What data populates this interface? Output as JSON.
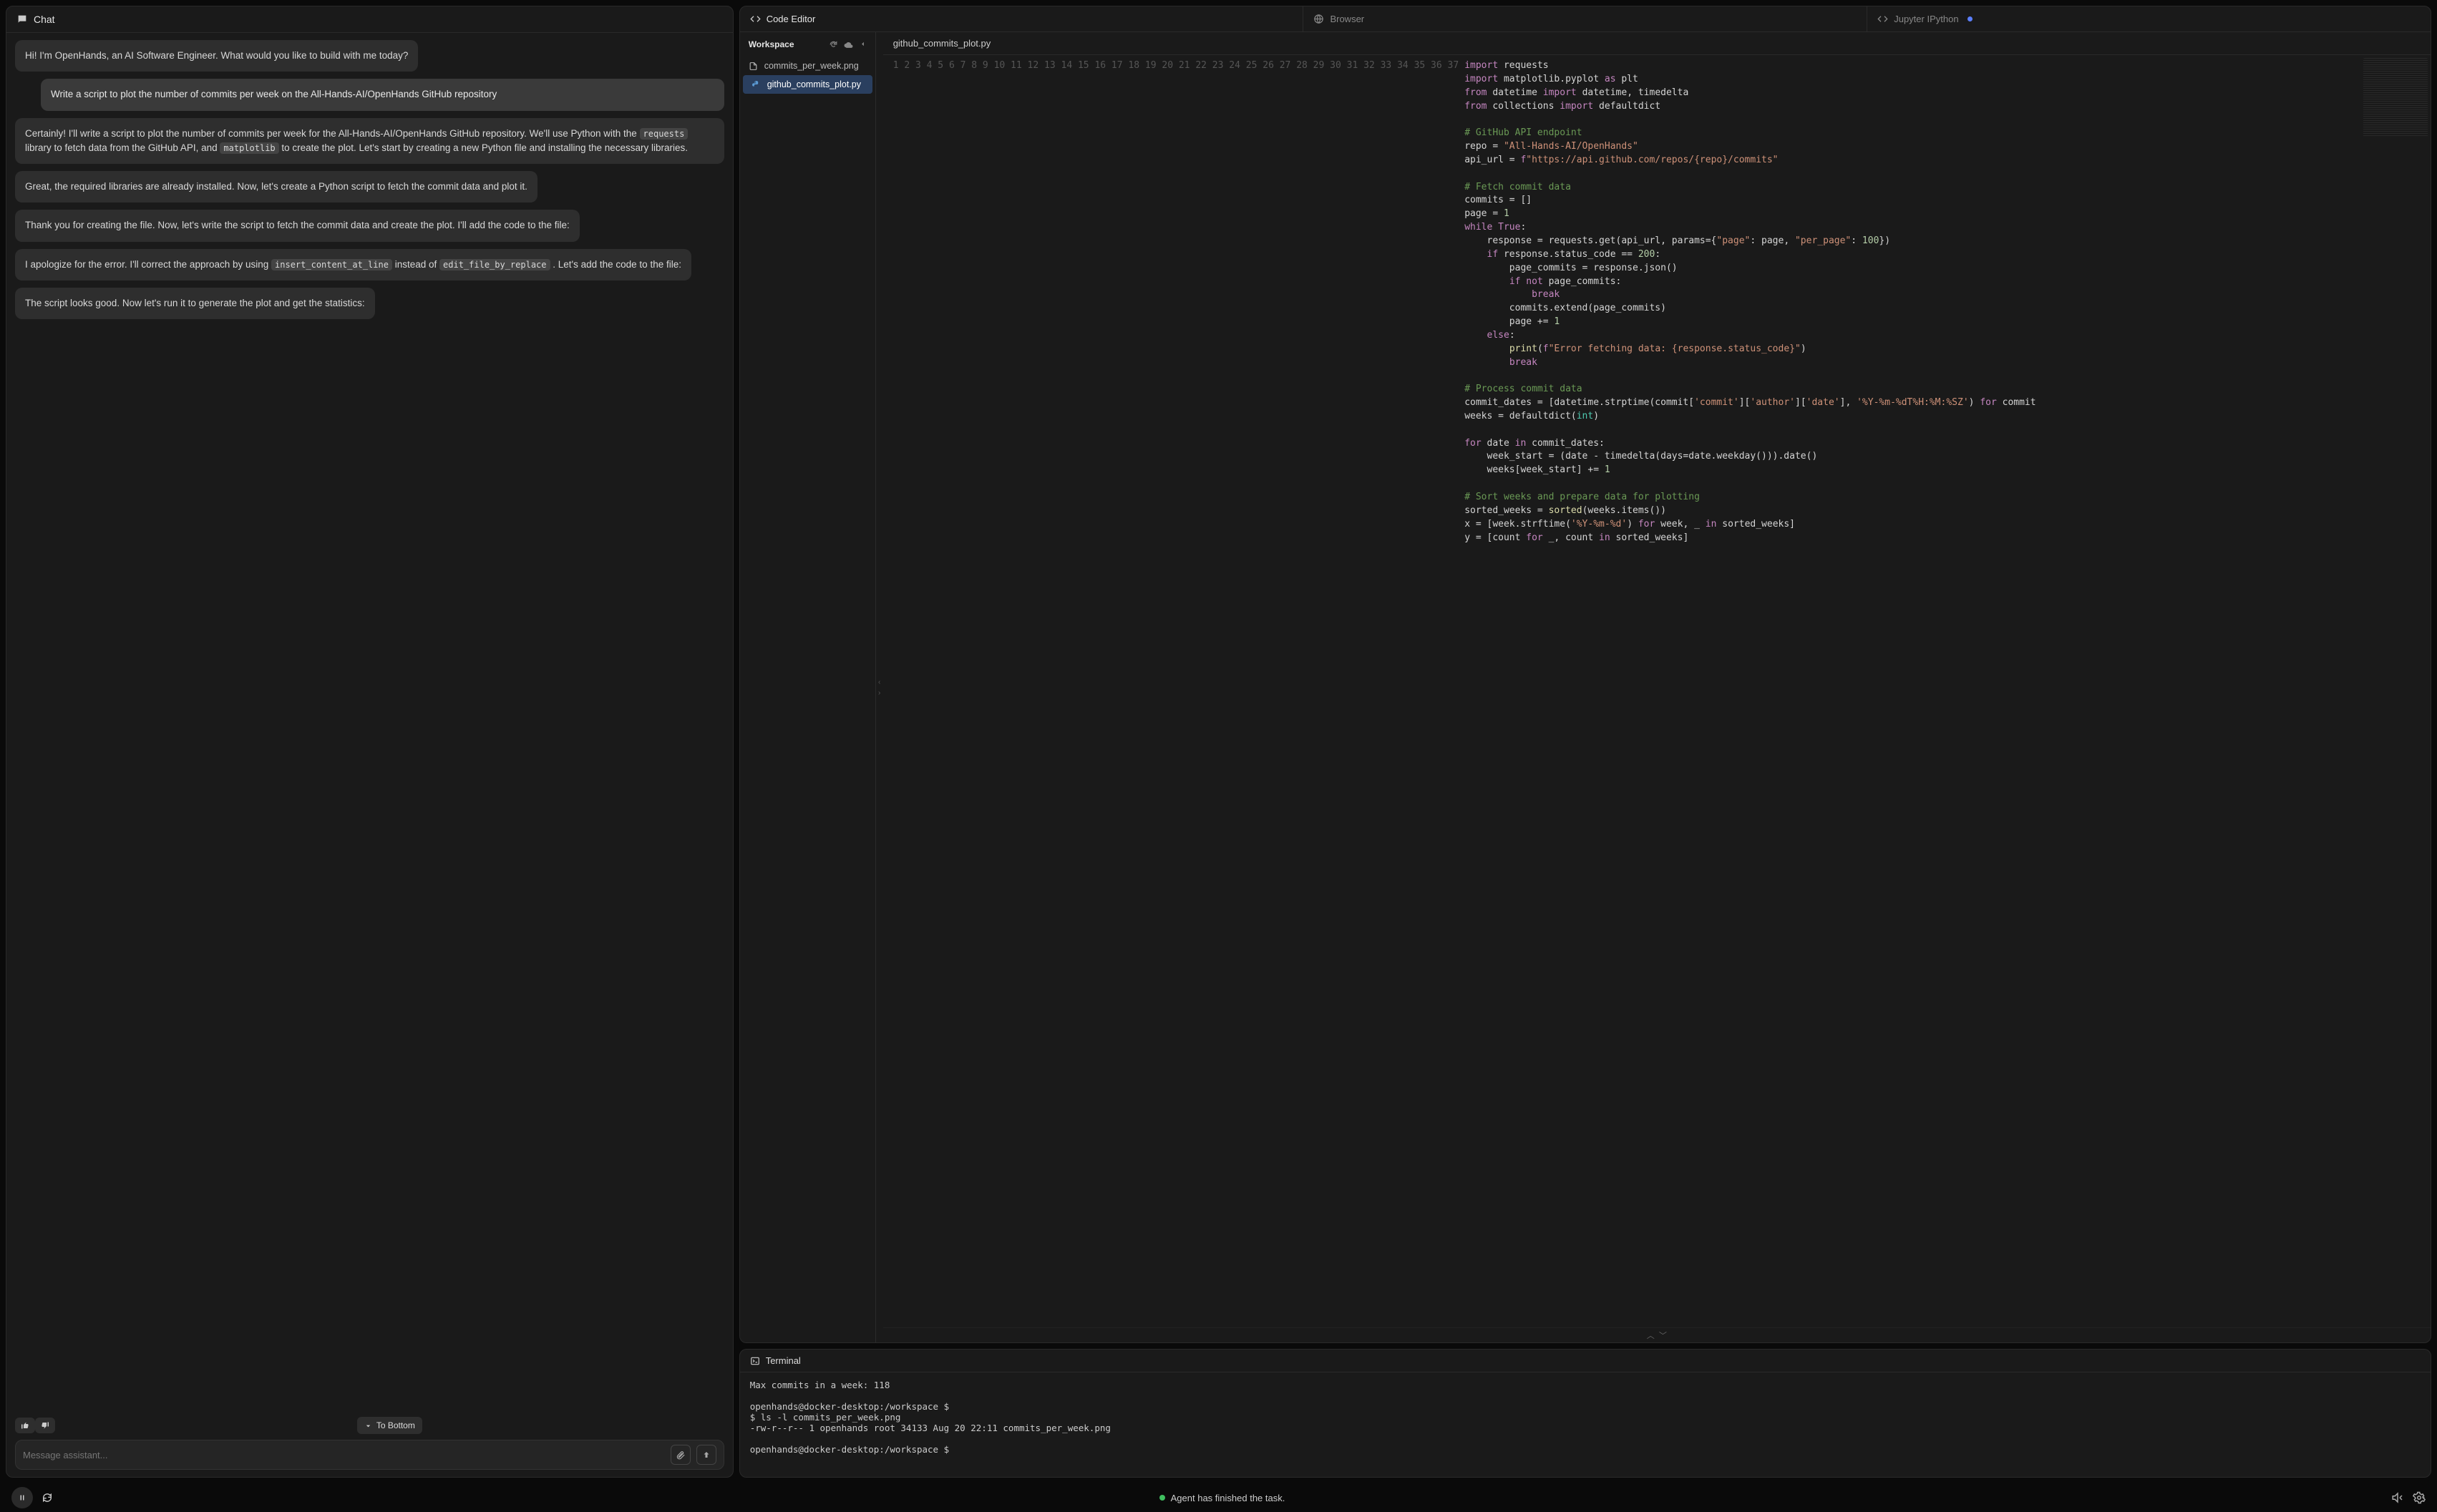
{
  "chat": {
    "title": "Chat",
    "messages": [
      {
        "role": "assistant",
        "text": "Hi! I'm OpenHands, an AI Software Engineer. What would you like to build with me today?"
      },
      {
        "role": "user",
        "text": "Write a script to plot the number of commits per week on the All-Hands-AI/OpenHands GitHub repository"
      },
      {
        "role": "assistant",
        "html": "Certainly! I'll write a script to plot the number of commits per week for the All-Hands-AI/OpenHands GitHub repository. We'll use Python with the <span class='code-chip'>requests</span> library to fetch data from the GitHub API, and <span class='code-chip'>matplotlib</span> to create the plot. Let's start by creating a new Python file and installing the necessary libraries."
      },
      {
        "role": "assistant",
        "text": "Great, the required libraries are already installed. Now, let's create a Python script to fetch the commit data and plot it."
      },
      {
        "role": "assistant",
        "text": "Thank you for creating the file. Now, let's write the script to fetch the commit data and create the plot. I'll add the code to the file:"
      },
      {
        "role": "assistant",
        "html": "I apologize for the error. I'll correct the approach by using <span class='code-chip'>insert_content_at_line</span> instead of <span class='code-chip'>edit_file_by_replace</span> . Let's add the code to the file:"
      },
      {
        "role": "assistant",
        "text": "The script looks good. Now let's run it to generate the plot and get the statistics:"
      }
    ],
    "to_bottom": "To Bottom",
    "input_placeholder": "Message assistant..."
  },
  "tabs": {
    "code": "Code Editor",
    "browser": "Browser",
    "jupyter": "Jupyter IPython"
  },
  "workspace": {
    "title": "Workspace",
    "files": [
      {
        "name": "commits_per_week.png",
        "type": "image",
        "selected": false
      },
      {
        "name": "github_commits_plot.py",
        "type": "python",
        "selected": true
      }
    ]
  },
  "open_file": "github_commits_plot.py",
  "code": {
    "lines": [
      [
        [
          "kw",
          "import"
        ],
        [
          "",
          " requests"
        ]
      ],
      [
        [
          "kw",
          "import"
        ],
        [
          "",
          " matplotlib.pyplot "
        ],
        [
          "kw",
          "as"
        ],
        [
          "",
          " plt"
        ]
      ],
      [
        [
          "kw",
          "from"
        ],
        [
          "",
          " datetime "
        ],
        [
          "kw",
          "import"
        ],
        [
          "",
          " datetime, timedelta"
        ]
      ],
      [
        [
          "kw",
          "from"
        ],
        [
          "",
          " collections "
        ],
        [
          "kw",
          "import"
        ],
        [
          "",
          " defaultdict"
        ]
      ],
      [],
      [
        [
          "com",
          "# GitHub API endpoint"
        ]
      ],
      [
        [
          "",
          "repo = "
        ],
        [
          "str",
          "\"All-Hands-AI/OpenHands\""
        ]
      ],
      [
        [
          "",
          "api_url = "
        ],
        [
          "kw",
          "f"
        ],
        [
          "str",
          "\"https://api.github.com/repos/{repo}/commits\""
        ]
      ],
      [],
      [
        [
          "com",
          "# Fetch commit data"
        ]
      ],
      [
        [
          "",
          "commits = []"
        ]
      ],
      [
        [
          "",
          "page = "
        ],
        [
          "num",
          "1"
        ]
      ],
      [
        [
          "kw",
          "while"
        ],
        [
          "",
          " "
        ],
        [
          "kw",
          "True"
        ],
        [
          "",
          ":"
        ]
      ],
      [
        [
          "",
          "    response = requests.get(api_url, params={"
        ],
        [
          "str",
          "\"page\""
        ],
        [
          "",
          ": page, "
        ],
        [
          "str",
          "\"per_page\""
        ],
        [
          "",
          ": "
        ],
        [
          "num",
          "100"
        ],
        [
          "",
          "})"
        ]
      ],
      [
        [
          "",
          "    "
        ],
        [
          "kw",
          "if"
        ],
        [
          "",
          " response.status_code == "
        ],
        [
          "num",
          "200"
        ],
        [
          "",
          ":"
        ]
      ],
      [
        [
          "",
          "        page_commits = response.json()"
        ]
      ],
      [
        [
          "",
          "        "
        ],
        [
          "kw",
          "if"
        ],
        [
          "",
          " "
        ],
        [
          "kw",
          "not"
        ],
        [
          "",
          " page_commits:"
        ]
      ],
      [
        [
          "",
          "            "
        ],
        [
          "kw",
          "break"
        ]
      ],
      [
        [
          "",
          "        commits.extend(page_commits)"
        ]
      ],
      [
        [
          "",
          "        page += "
        ],
        [
          "num",
          "1"
        ]
      ],
      [
        [
          "",
          "    "
        ],
        [
          "kw",
          "else"
        ],
        [
          "",
          ":"
        ]
      ],
      [
        [
          "",
          "        "
        ],
        [
          "fn",
          "print"
        ],
        [
          "",
          "("
        ],
        [
          "kw",
          "f"
        ],
        [
          "str",
          "\"Error fetching data: {response.status_code}\""
        ],
        [
          "",
          ")"
        ]
      ],
      [
        [
          "",
          "        "
        ],
        [
          "kw",
          "break"
        ]
      ],
      [],
      [
        [
          "com",
          "# Process commit data"
        ]
      ],
      [
        [
          "",
          "commit_dates = [datetime.strptime(commit["
        ],
        [
          "str",
          "'commit'"
        ],
        [
          "",
          "]["
        ],
        [
          "str",
          "'author'"
        ],
        [
          "",
          "]["
        ],
        [
          "str",
          "'date'"
        ],
        [
          "",
          "], "
        ],
        [
          "str",
          "'%Y-%m-%dT%H:%M:%SZ'"
        ],
        [
          "",
          ") "
        ],
        [
          "kw",
          "for"
        ],
        [
          "",
          " commit"
        ]
      ],
      [
        [
          "",
          "weeks = defaultdict("
        ],
        [
          "type",
          "int"
        ],
        [
          "",
          ")"
        ]
      ],
      [],
      [
        [
          "kw",
          "for"
        ],
        [
          "",
          " date "
        ],
        [
          "kw",
          "in"
        ],
        [
          "",
          " commit_dates:"
        ]
      ],
      [
        [
          "",
          "    week_start = (date - timedelta(days=date.weekday())).date()"
        ]
      ],
      [
        [
          "",
          "    weeks[week_start] += "
        ],
        [
          "num",
          "1"
        ]
      ],
      [],
      [
        [
          "com",
          "# Sort weeks and prepare data for plotting"
        ]
      ],
      [
        [
          "",
          "sorted_weeks = "
        ],
        [
          "fn",
          "sorted"
        ],
        [
          "",
          "(weeks.items())"
        ]
      ],
      [
        [
          "",
          "x = [week.strftime("
        ],
        [
          "str",
          "'%Y-%m-%d'"
        ],
        [
          "",
          ") "
        ],
        [
          "kw",
          "for"
        ],
        [
          "",
          " week, _ "
        ],
        [
          "kw",
          "in"
        ],
        [
          "",
          " sorted_weeks]"
        ]
      ],
      [
        [
          "",
          "y = [count "
        ],
        [
          "kw",
          "for"
        ],
        [
          "",
          " _, count "
        ],
        [
          "kw",
          "in"
        ],
        [
          "",
          " sorted_weeks]"
        ]
      ],
      []
    ]
  },
  "terminal": {
    "title": "Terminal",
    "lines": [
      "Max commits in a week: 118",
      "",
      "openhands@docker-desktop:/workspace $",
      "$ ls -l commits_per_week.png",
      "-rw-r--r-- 1 openhands root 34133 Aug 20 22:11 commits_per_week.png",
      "",
      "openhands@docker-desktop:/workspace $"
    ]
  },
  "status": {
    "message": "Agent has finished the task."
  },
  "icons": {
    "chat": "chat-bubble",
    "code": "code-brackets",
    "globe": "globe",
    "attach": "paperclip",
    "send": "arrow-up"
  }
}
